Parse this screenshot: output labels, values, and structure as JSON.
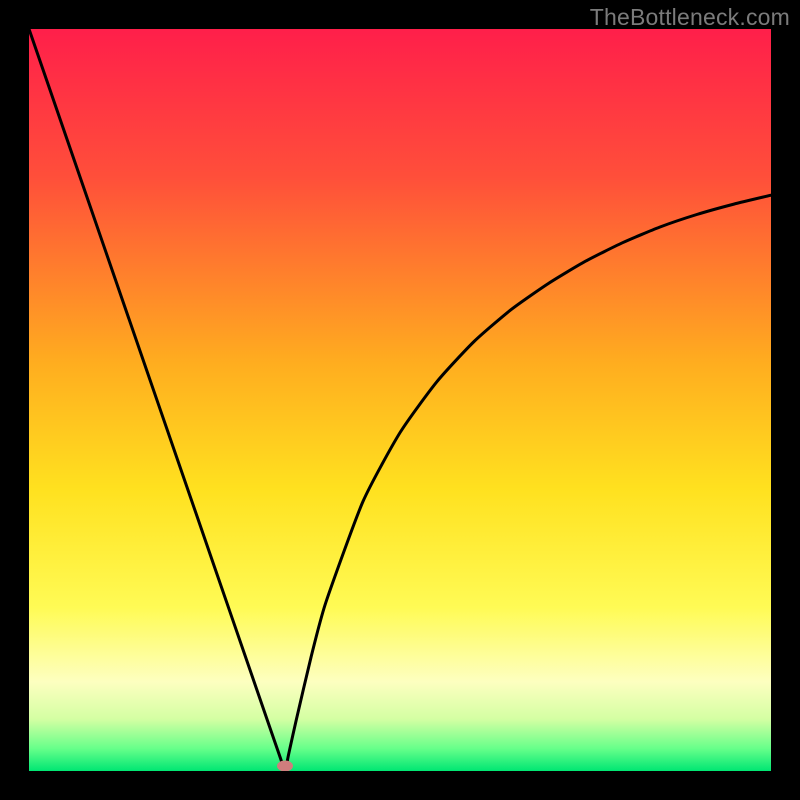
{
  "watermark": "TheBottleneck.com",
  "chart_data": {
    "type": "line",
    "title": "",
    "xlabel": "",
    "ylabel": "",
    "xlim": [
      0,
      100
    ],
    "ylim": [
      0,
      100
    ],
    "note": "Bottleneck-style curve: percentage/metric on y, resource balance on x. Minimum (sweet spot) near x≈34.5. Values are estimated from pixel positions since the chart has no axis ticks or numeric labels.",
    "x": [
      0,
      5,
      10,
      15,
      20,
      25,
      30,
      32,
      33,
      34,
      34.5,
      35,
      36,
      38,
      40,
      45,
      50,
      55,
      60,
      65,
      70,
      75,
      80,
      85,
      90,
      95,
      100
    ],
    "values": [
      100,
      85.5,
      71,
      56.5,
      42,
      27.5,
      13,
      7.2,
      4.3,
      1.4,
      0,
      2.3,
      6.8,
      15.3,
      22.7,
      36.3,
      45.6,
      52.5,
      57.9,
      62.2,
      65.7,
      68.7,
      71.2,
      73.3,
      75.0,
      76.4,
      77.6
    ],
    "minimum_marker": {
      "x": 34.5,
      "y": 0,
      "color": "#cf7d7d"
    },
    "gradient_stops": [
      {
        "offset": 0,
        "color": "#ff1f4a"
      },
      {
        "offset": 0.2,
        "color": "#ff4f3a"
      },
      {
        "offset": 0.45,
        "color": "#ffad1f"
      },
      {
        "offset": 0.62,
        "color": "#ffe11f"
      },
      {
        "offset": 0.78,
        "color": "#fffb55"
      },
      {
        "offset": 0.88,
        "color": "#fdffc0"
      },
      {
        "offset": 0.93,
        "color": "#d4ffa3"
      },
      {
        "offset": 0.97,
        "color": "#66ff8a"
      },
      {
        "offset": 1.0,
        "color": "#00e673"
      }
    ]
  }
}
